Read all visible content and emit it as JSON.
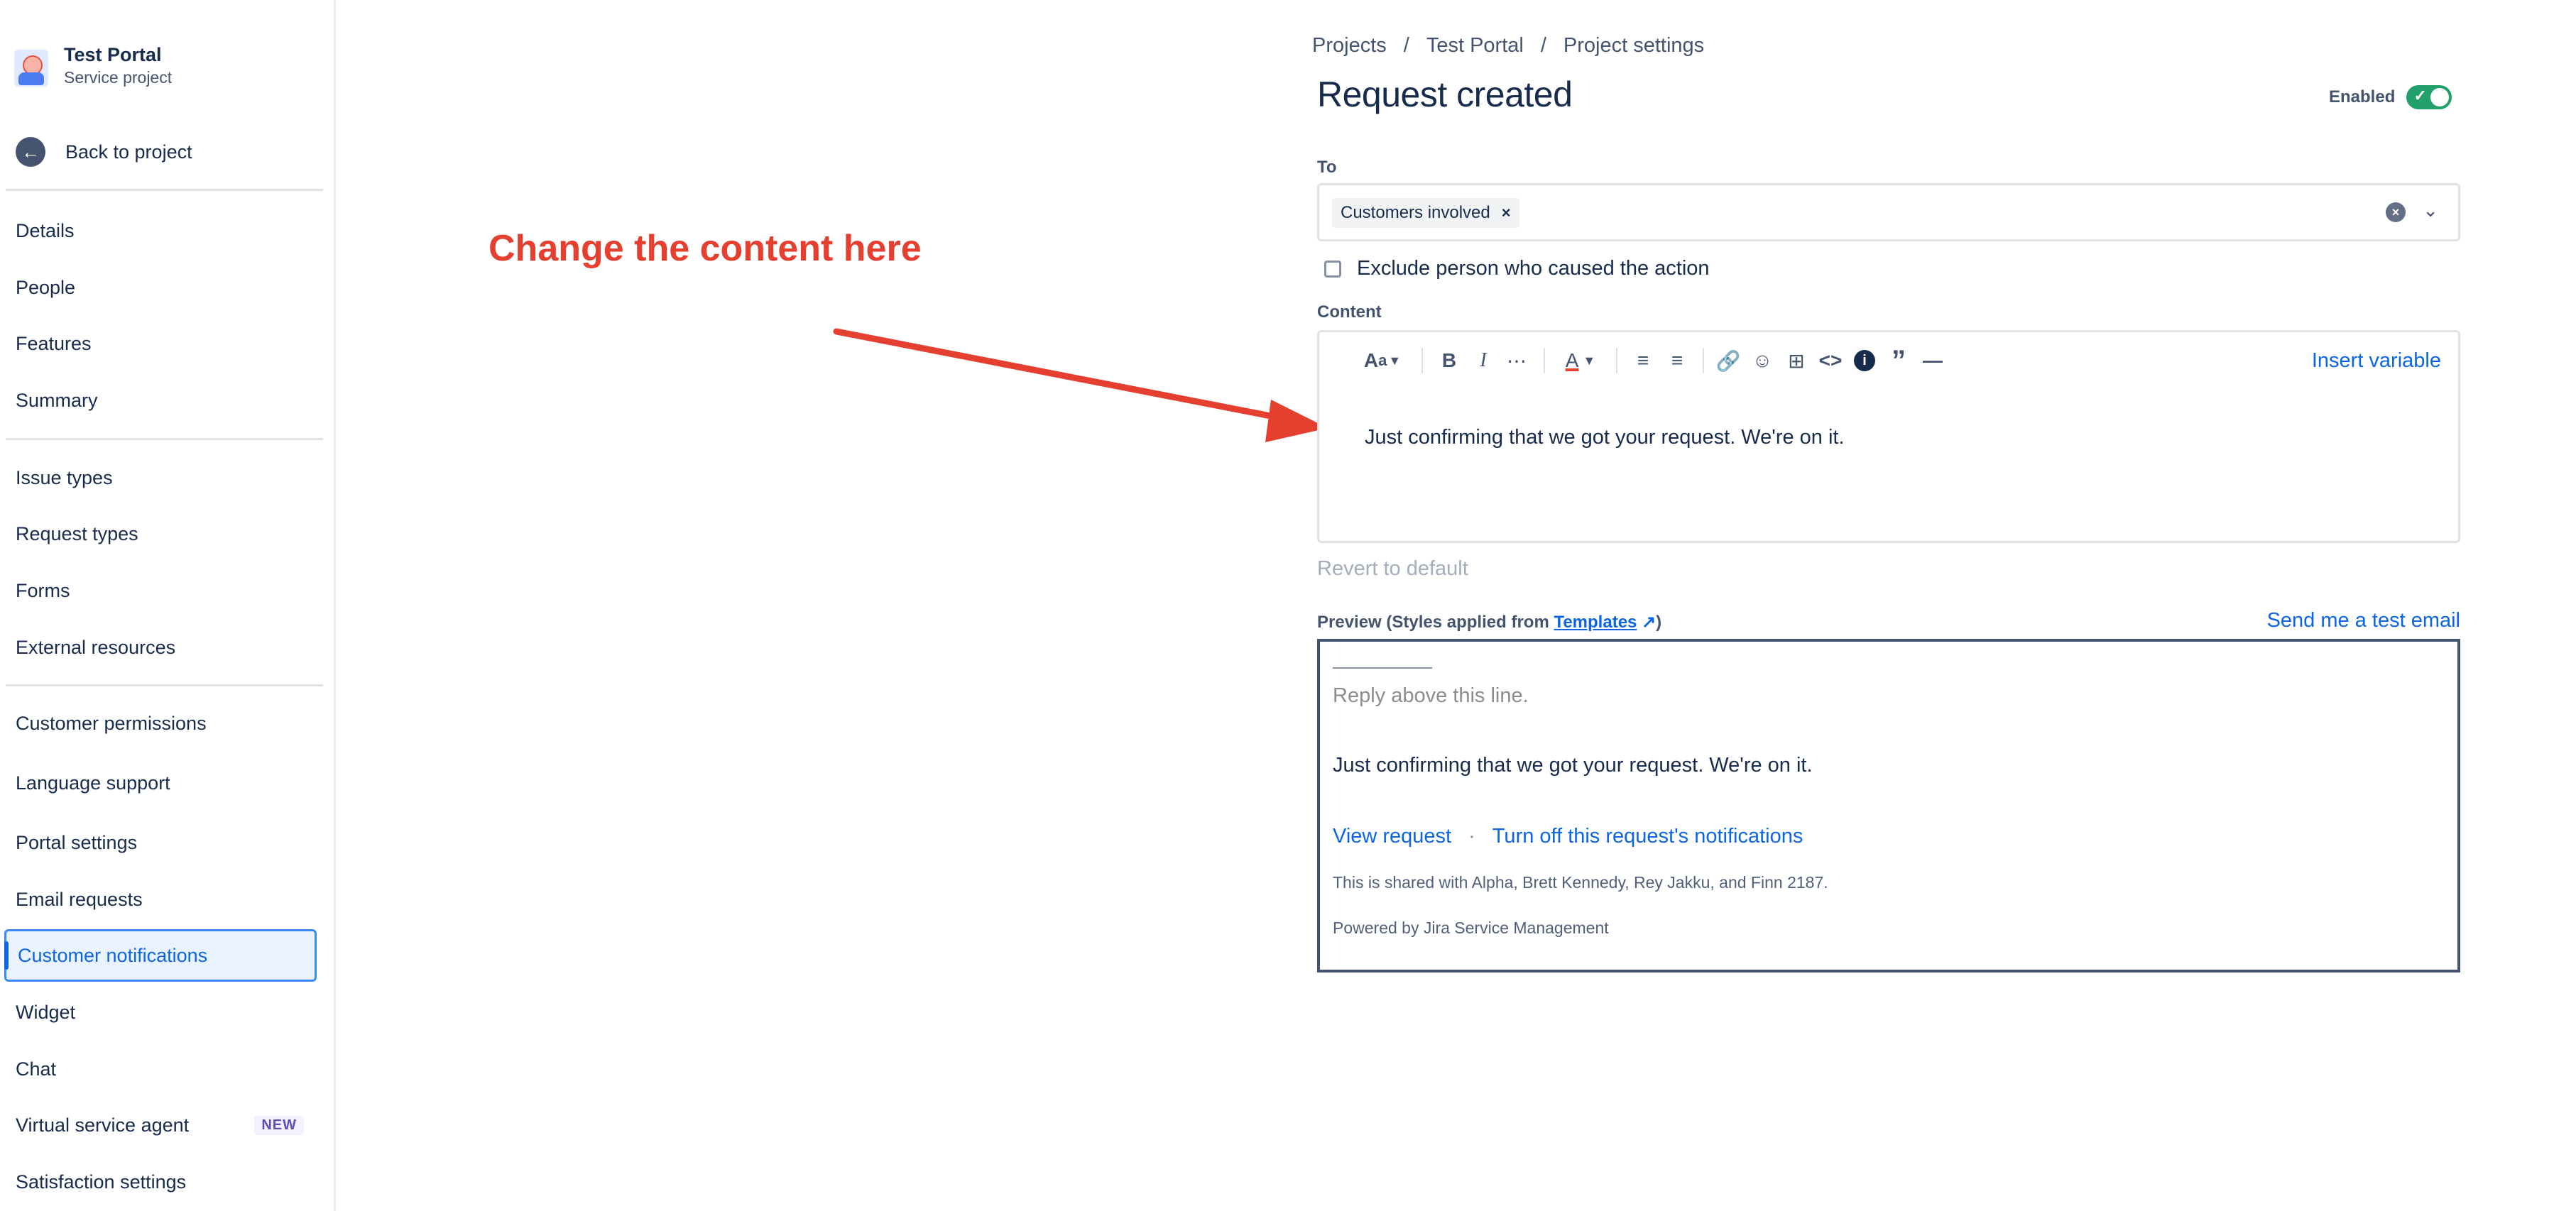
{
  "sidebar": {
    "project_title": "Test Portal",
    "project_subtitle": "Service project",
    "back_label": "Back to project",
    "items": [
      {
        "label": "Details"
      },
      {
        "label": "People"
      },
      {
        "label": "Features"
      },
      {
        "label": "Summary"
      },
      {
        "label": "Issue types"
      },
      {
        "label": "Request types"
      },
      {
        "label": "Forms"
      },
      {
        "label": "External resources"
      },
      {
        "label": "Customer permissions"
      },
      {
        "label": "Language support"
      },
      {
        "label": "Portal settings"
      },
      {
        "label": "Email requests"
      },
      {
        "label": "Customer notifications"
      },
      {
        "label": "Widget"
      },
      {
        "label": "Chat"
      },
      {
        "label": "Virtual service agent",
        "badge": "NEW"
      },
      {
        "label": "Satisfaction settings"
      }
    ],
    "active_item": "Customer notifications"
  },
  "annotation": {
    "text": "Change the content here",
    "color": "#e5402f"
  },
  "breadcrumb": [
    "Projects",
    "Test Portal",
    "Project settings"
  ],
  "breadcrumb_separator": "/",
  "page": {
    "title": "Request created",
    "enabled_label": "Enabled",
    "enabled": true
  },
  "to_field": {
    "label": "To",
    "chips": [
      "Customers involved"
    ],
    "chip_remove": "×"
  },
  "exclude_checkbox": {
    "label": "Exclude person who caused the action",
    "checked": false
  },
  "content_field": {
    "label": "Content",
    "insert_variable": "Insert variable",
    "text": "Just confirming that we got your request. We're on it.",
    "toolbar_icons": [
      "text-style-icon",
      "bold-icon",
      "italic-icon",
      "more-formatting-icon",
      "text-color-icon",
      "bullet-list-icon",
      "numbered-list-icon",
      "link-icon",
      "emoji-icon",
      "table-icon",
      "code-icon",
      "info-panel-icon",
      "quote-icon",
      "divider-icon"
    ]
  },
  "revert_label": "Revert to default",
  "preview": {
    "label_prefix": "Preview (Styles applied from ",
    "label_link": "Templates",
    "label_suffix": ")",
    "test_email": "Send me a test email",
    "reply_line": "Reply above this line.",
    "body": "Just confirming that we got your request. We're on it.",
    "view_request": "View request",
    "dot": "·",
    "turn_off": "Turn off this request's notifications",
    "shared": "This is shared with Alpha, Brett Kennedy, Rey Jakku, and Finn 2187.",
    "powered": "Powered by Jira Service Management"
  },
  "colors": {
    "accent": "#0c66e4",
    "toggle_on": "#22a06b",
    "text": "#172b4d"
  }
}
